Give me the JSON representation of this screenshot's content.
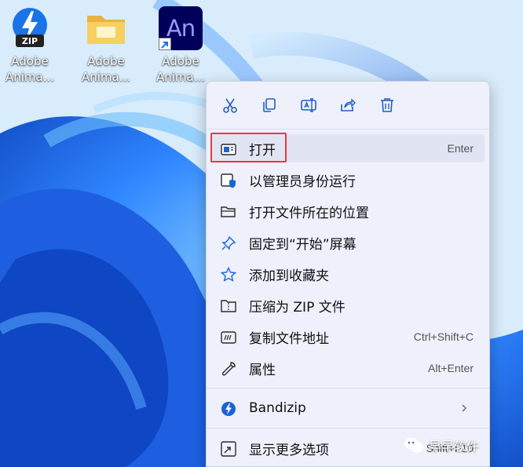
{
  "desktop": {
    "icons": [
      {
        "label": "Adobe\nAnima...",
        "icon": "bandizip-zip-icon",
        "badge": "ZIP"
      },
      {
        "label": "Adobe\nAnima...",
        "icon": "folder-icon"
      },
      {
        "label": "Adobe\nAnima...",
        "icon": "adobe-animate-icon",
        "tile_text": "An"
      }
    ]
  },
  "context_menu": {
    "toolbar": [
      "cut-icon",
      "copy-icon",
      "rename-icon",
      "share-icon",
      "delete-icon"
    ],
    "items": [
      {
        "label": "打开",
        "shortcut": "Enter",
        "icon": "open-window-icon",
        "highlighted": true
      },
      {
        "label": "以管理员身份运行",
        "shortcut": "",
        "icon": "admin-shield-icon"
      },
      {
        "label": "打开文件所在的位置",
        "shortcut": "",
        "icon": "folder-open-icon"
      },
      {
        "label": "固定到“开始”屏幕",
        "shortcut": "",
        "icon": "pin-icon"
      },
      {
        "label": "添加到收藏夹",
        "shortcut": "",
        "icon": "star-icon"
      },
      {
        "label": "压缩为 ZIP 文件",
        "shortcut": "",
        "icon": "zip-folder-icon"
      },
      {
        "label": "复制文件地址",
        "shortcut": "Ctrl+Shift+C",
        "icon": "copy-path-icon"
      },
      {
        "label": "属性",
        "shortcut": "Alt+Enter",
        "icon": "wrench-icon"
      },
      {
        "label": "Bandizip",
        "shortcut": "",
        "icon": "bandizip-icon",
        "submenu": true
      },
      {
        "label": "显示更多选项",
        "shortcut": "Shift+F10",
        "icon": "more-options-icon"
      }
    ]
  },
  "watermark": {
    "text": "早早软件",
    "icon": "wechat-icon"
  },
  "colors": {
    "accent": "#1a73e8",
    "highlight_box": "#e63a3a",
    "menu_bg": "#eef0fb",
    "an_tile": "#00005b",
    "an_text": "#9999ff"
  }
}
